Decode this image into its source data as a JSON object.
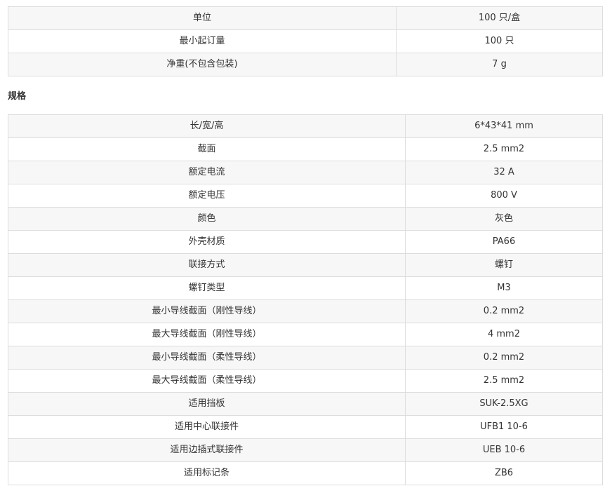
{
  "summary_rows": [
    {
      "label": "单位",
      "value": "100 只/盒"
    },
    {
      "label": "最小起订量",
      "value": "100 只"
    },
    {
      "label": "净重(不包含包装)",
      "value": "7 g"
    }
  ],
  "section_title": "规格",
  "spec_rows": [
    {
      "label": "长/宽/高",
      "value": "6*43*41 mm"
    },
    {
      "label": "截面",
      "value": "2.5 mm2"
    },
    {
      "label": "额定电流",
      "value": "32 A"
    },
    {
      "label": "额定电压",
      "value": "800 V"
    },
    {
      "label": "颜色",
      "value": "灰色"
    },
    {
      "label": "外壳材质",
      "value": "PA66"
    },
    {
      "label": "联接方式",
      "value": "螺钉"
    },
    {
      "label": "螺钉类型",
      "value": "M3"
    },
    {
      "label": "最小导线截面（刚性导线）",
      "value": "0.2 mm2"
    },
    {
      "label": "最大导线截面（刚性导线）",
      "value": "4 mm2"
    },
    {
      "label": "最小导线截面（柔性导线）",
      "value": "0.2 mm2"
    },
    {
      "label": "最大导线截面（柔性导线）",
      "value": "2.5 mm2"
    },
    {
      "label": "适用挡板",
      "value": "SUK-2.5XG"
    },
    {
      "label": "适用中心联接件",
      "value": "UFB1 10-6"
    },
    {
      "label": "适用边插式联接件",
      "value": "UEB 10-6"
    },
    {
      "label": "适用标记条",
      "value": "ZB6"
    }
  ]
}
